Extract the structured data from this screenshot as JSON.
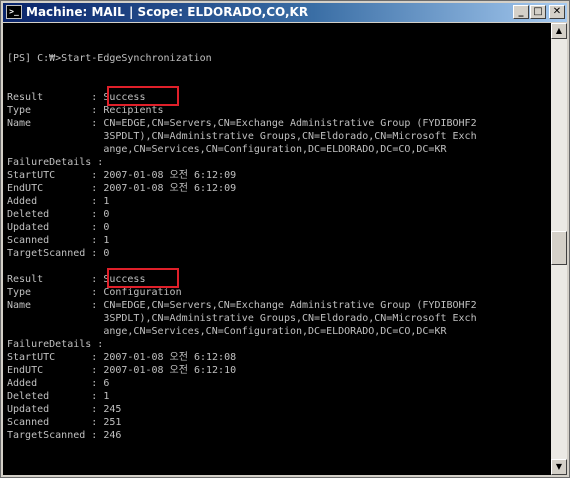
{
  "window": {
    "title": "Machine: MAIL | Scope: ELDORADO,CO,KR",
    "icon": "powershell-icon",
    "minimize_icon": "minimize-icon",
    "maximize_icon": "maximize-icon",
    "close_icon": "close-icon"
  },
  "console": {
    "lines": [
      "[PS] C:₩>Start-EdgeSynchronization",
      "",
      "",
      "Result        : Success",
      "Type          : Recipients",
      "Name          : CN=EDGE,CN=Servers,CN=Exchange Administrative Group (FYDIBOHF2",
      "                3SPDLT),CN=Administrative Groups,CN=Eldorado,CN=Microsoft Exch",
      "                ange,CN=Services,CN=Configuration,DC=ELDORADO,DC=CO,DC=KR",
      "FailureDetails :",
      "StartUTC      : 2007-01-08 오전 6:12:09",
      "EndUTC        : 2007-01-08 오전 6:12:09",
      "Added         : 1",
      "Deleted       : 0",
      "Updated       : 0",
      "Scanned       : 1",
      "TargetScanned : 0",
      "",
      "Result        : Success",
      "Type          : Configuration",
      "Name          : CN=EDGE,CN=Servers,CN=Exchange Administrative Group (FYDIBOHF2",
      "                3SPDLT),CN=Administrative Groups,CN=Eldorado,CN=Microsoft Exch",
      "                ange,CN=Services,CN=Configuration,DC=ELDORADO,DC=CO,DC=KR",
      "FailureDetails :",
      "StartUTC      : 2007-01-08 오전 6:12:08",
      "EndUTC        : 2007-01-08 오전 6:12:10",
      "Added         : 6",
      "Deleted       : 1",
      "Updated       : 245",
      "Scanned       : 251",
      "TargetScanned : 246"
    ]
  },
  "highlight_color": "#e0202a",
  "scrollbar": {
    "up_icon": "scroll-up-icon",
    "down_icon": "scroll-down-icon"
  }
}
